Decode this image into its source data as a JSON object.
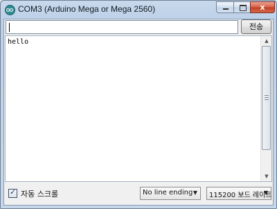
{
  "window": {
    "title": "COM3 (Arduino Mega or Mega 2560)",
    "controls": {
      "minimize": "",
      "maximize": "",
      "close": "x"
    }
  },
  "send": {
    "input_value": "",
    "button_label": "전송"
  },
  "console": {
    "output": "hello"
  },
  "footer": {
    "autoscroll_label": "자동 스크롤",
    "autoscroll_checked": true,
    "line_ending": "No line ending",
    "baud_rate": "115200 보드 레이트"
  }
}
